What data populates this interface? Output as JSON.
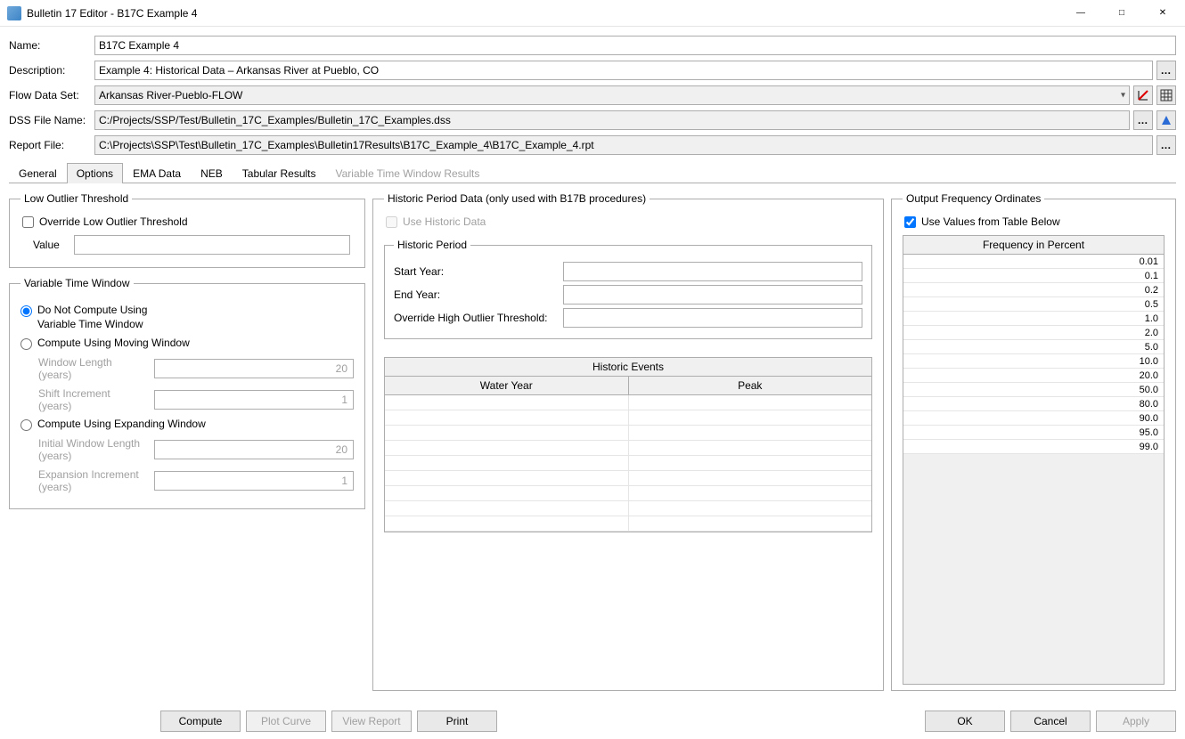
{
  "window": {
    "title": "Bulletin 17 Editor - B17C Example 4"
  },
  "form": {
    "name_label": "Name:",
    "name_value": "B17C Example 4",
    "desc_label": "Description:",
    "desc_value": "Example 4: Historical Data – Arkansas River at Pueblo, CO",
    "flow_label": "Flow Data Set:",
    "flow_value": "Arkansas River-Pueblo-FLOW",
    "dss_label": "DSS File Name:",
    "dss_value": "C:/Projects/SSP/Test/Bulletin_17C_Examples/Bulletin_17C_Examples.dss",
    "report_label": "Report File:",
    "report_value": "C:\\Projects\\SSP\\Test\\Bulletin_17C_Examples\\Bulletin17Results\\B17C_Example_4\\B17C_Example_4.rpt"
  },
  "tabs": {
    "general": "General",
    "options": "Options",
    "ema": "EMA Data",
    "neb": "NEB",
    "tabular": "Tabular Results",
    "vtw": "Variable Time Window Results"
  },
  "low_outlier": {
    "legend": "Low Outlier Threshold",
    "override": "Override Low Outlier Threshold",
    "value_label": "Value"
  },
  "vtw": {
    "legend": "Variable Time Window",
    "r1a": "Do Not Compute Using",
    "r1b": "Variable Time Window",
    "r2": "Compute Using Moving Window",
    "wl_label": "Window Length\n(years)",
    "wl_val": "20",
    "si_label": "Shift Increment\n(years)",
    "si_val": "1",
    "r3": "Compute Using Expanding Window",
    "iwl_label": "Initial Window Length\n(years)",
    "iwl_val": "20",
    "ei_label": "Expansion Increment\n(years)",
    "ei_val": "1"
  },
  "historic": {
    "legend": "Historic Period Data (only used with B17B procedures)",
    "use": "Use Historic Data",
    "sub_legend": "Historic Period",
    "start": "Start Year:",
    "end": "End Year:",
    "override": "Override High Outlier Threshold:",
    "events_title": "Historic Events",
    "col1": "Water Year",
    "col2": "Peak"
  },
  "output": {
    "legend": "Output Frequency Ordinates",
    "use": "Use Values from Table Below",
    "col": "Frequency in Percent",
    "values": [
      "0.01",
      "0.1",
      "0.2",
      "0.5",
      "1.0",
      "2.0",
      "5.0",
      "10.0",
      "20.0",
      "50.0",
      "80.0",
      "90.0",
      "95.0",
      "99.0"
    ]
  },
  "buttons": {
    "compute": "Compute",
    "plot": "Plot Curve",
    "view": "View Report",
    "print": "Print",
    "ok": "OK",
    "cancel": "Cancel",
    "apply": "Apply"
  }
}
